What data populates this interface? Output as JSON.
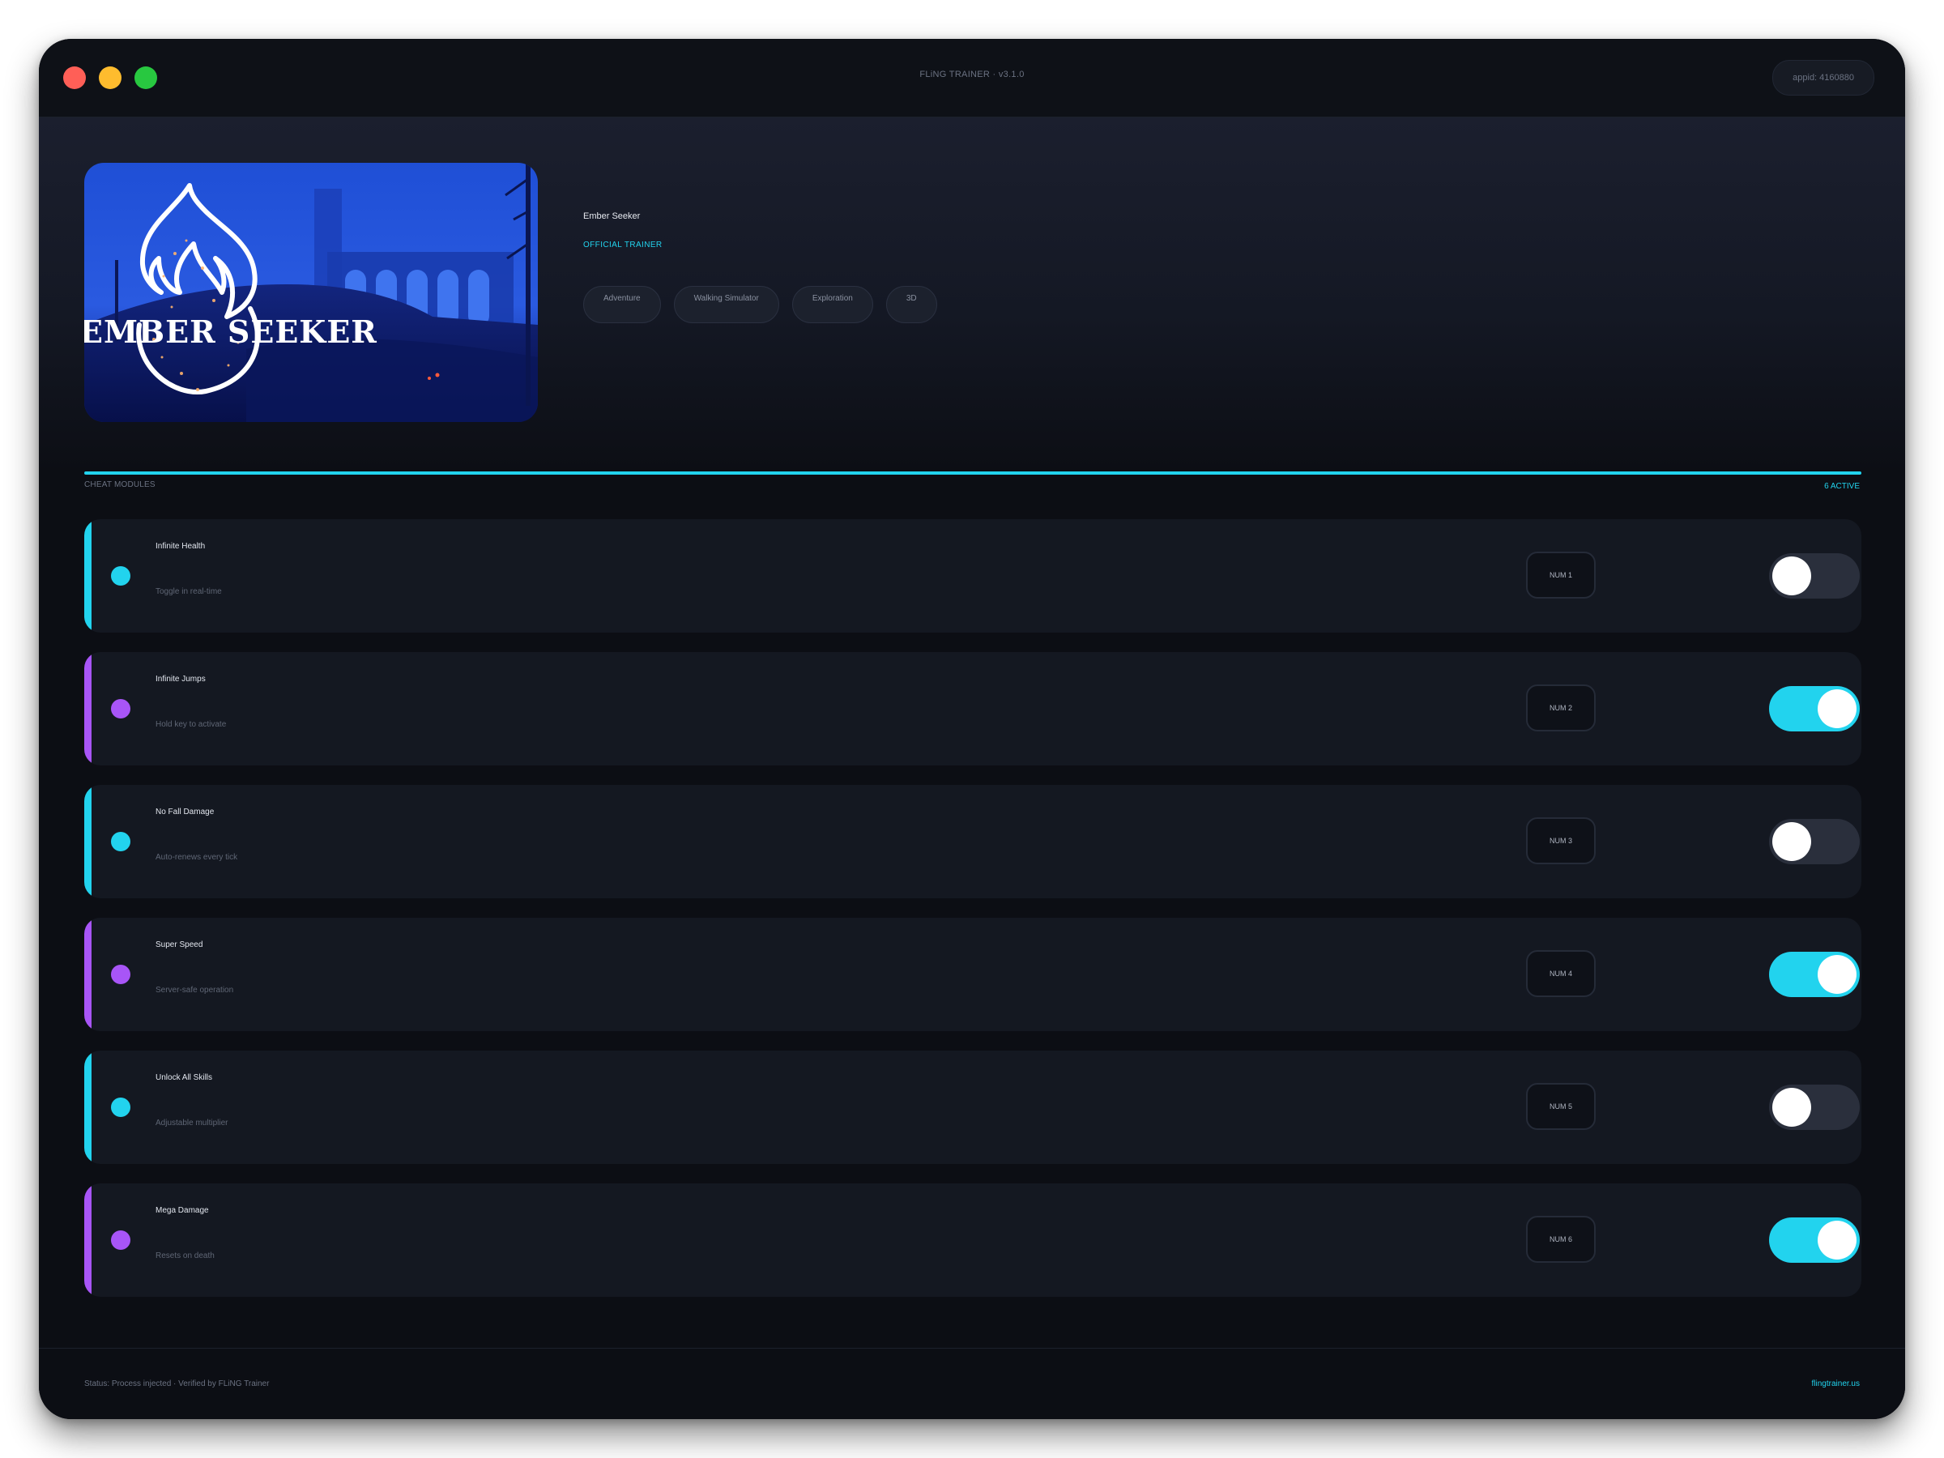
{
  "window": {
    "title": "FLiNG TRAINER · v3.1.0",
    "appid": "appid: 4160880"
  },
  "game": {
    "title": "Ember Seeker",
    "cover_logo_text": "EMBER SEEKER",
    "badge": "OFFICIAL TRAINER",
    "tags": [
      "Adventure",
      "Walking Simulator",
      "Exploration",
      "3D"
    ]
  },
  "section": {
    "label": "CHEAT MODULES",
    "active_count": "6 ACTIVE"
  },
  "cheats": [
    {
      "name": "Infinite Health",
      "desc": "Toggle in real-time",
      "hotkey": "NUM 1",
      "on": false,
      "accent": "#22d3ee"
    },
    {
      "name": "Infinite Jumps",
      "desc": "Hold key to activate",
      "hotkey": "NUM 2",
      "on": true,
      "accent": "#a855f7"
    },
    {
      "name": "No Fall Damage",
      "desc": "Auto-renews every tick",
      "hotkey": "NUM 3",
      "on": false,
      "accent": "#22d3ee"
    },
    {
      "name": "Super Speed",
      "desc": "Server-safe operation",
      "hotkey": "NUM 4",
      "on": true,
      "accent": "#a855f7"
    },
    {
      "name": "Unlock All Skills",
      "desc": "Adjustable multiplier",
      "hotkey": "NUM 5",
      "on": false,
      "accent": "#22d3ee"
    },
    {
      "name": "Mega Damage",
      "desc": "Resets on death",
      "hotkey": "NUM 6",
      "on": true,
      "accent": "#a855f7"
    }
  ],
  "footer": {
    "status": "Status: Process injected · Verified by FLiNG Trainer",
    "site": "flingtrainer.us"
  },
  "colors": {
    "accent_cyan": "#22d3ee",
    "accent_purple": "#a855f7",
    "background": "#0c0e14",
    "card": "#141821"
  }
}
